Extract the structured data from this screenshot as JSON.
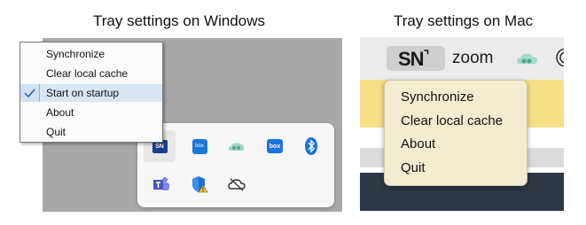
{
  "captions": {
    "windows": "Tray settings on Windows",
    "mac": "Tray settings on Mac"
  },
  "windows": {
    "menu_items": [
      {
        "label": "Synchronize",
        "checked": false
      },
      {
        "label": "Clear local cache",
        "checked": false
      },
      {
        "label": "Start on startup",
        "checked": true
      },
      {
        "label": "About",
        "checked": false
      },
      {
        "label": "Quit",
        "checked": false
      }
    ],
    "tray_icons": {
      "sn": "SN",
      "box_drive": "box",
      "box": "box"
    }
  },
  "mac": {
    "menubar": {
      "sn_logo": "SN",
      "zoom": "zoom"
    },
    "menu_items": [
      "Synchronize",
      "Clear local cache",
      "About",
      "Quit"
    ]
  }
}
